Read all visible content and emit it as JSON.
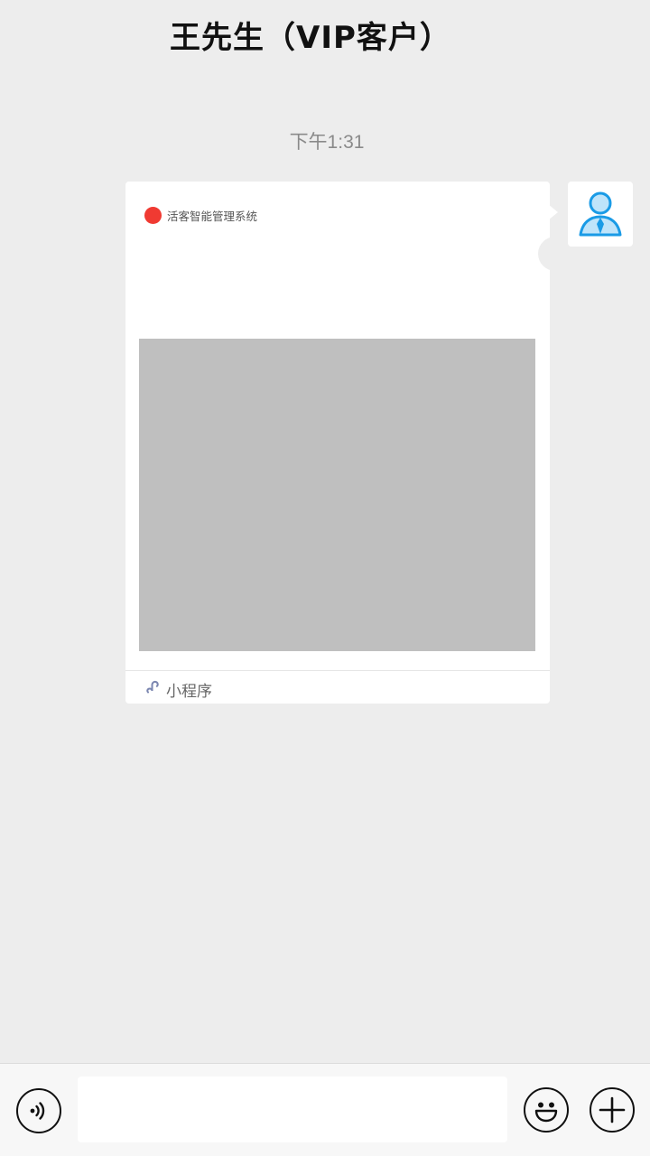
{
  "header": {
    "title": "王先生（VIP客户）"
  },
  "chat": {
    "timestamp": "下午1:31",
    "card": {
      "app_name": "活客智能管理系统",
      "footer_label": "小程序"
    }
  },
  "icons": {
    "voice": "voice-icon",
    "emoji": "emoji-icon",
    "plus": "plus-icon",
    "mini_program": "mini-program-icon",
    "avatar": "user-avatar-icon"
  },
  "colors": {
    "background": "#ededed",
    "app_dot": "#f03a32",
    "avatar_blue": "#1a9be6",
    "preview_gray": "#bfbfbf"
  },
  "composer": {
    "input_value": "",
    "placeholder": ""
  }
}
